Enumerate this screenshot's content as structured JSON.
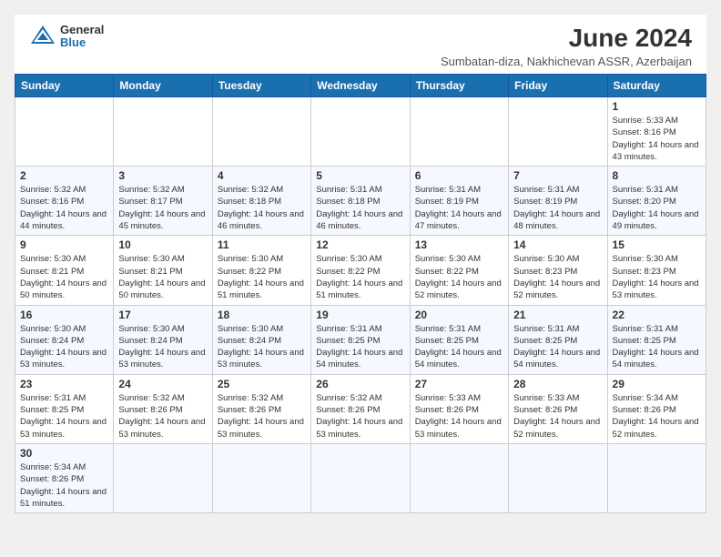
{
  "header": {
    "logo_general": "General",
    "logo_blue": "Blue",
    "month_title": "June 2024",
    "subtitle": "Sumbatan-diza, Nakhichevan ASSR, Azerbaijan"
  },
  "days_of_week": [
    "Sunday",
    "Monday",
    "Tuesday",
    "Wednesday",
    "Thursday",
    "Friday",
    "Saturday"
  ],
  "weeks": [
    [
      {
        "day": "",
        "info": ""
      },
      {
        "day": "",
        "info": ""
      },
      {
        "day": "",
        "info": ""
      },
      {
        "day": "",
        "info": ""
      },
      {
        "day": "",
        "info": ""
      },
      {
        "day": "",
        "info": ""
      },
      {
        "day": "1",
        "info": "Sunrise: 5:33 AM\nSunset: 8:16 PM\nDaylight: 14 hours\nand 43 minutes."
      }
    ],
    [
      {
        "day": "2",
        "info": "Sunrise: 5:32 AM\nSunset: 8:16 PM\nDaylight: 14 hours\nand 44 minutes."
      },
      {
        "day": "3",
        "info": "Sunrise: 5:32 AM\nSunset: 8:17 PM\nDaylight: 14 hours\nand 45 minutes."
      },
      {
        "day": "4",
        "info": "Sunrise: 5:32 AM\nSunset: 8:18 PM\nDaylight: 14 hours\nand 46 minutes."
      },
      {
        "day": "5",
        "info": "Sunrise: 5:31 AM\nSunset: 8:18 PM\nDaylight: 14 hours\nand 46 minutes."
      },
      {
        "day": "6",
        "info": "Sunrise: 5:31 AM\nSunset: 8:19 PM\nDaylight: 14 hours\nand 47 minutes."
      },
      {
        "day": "7",
        "info": "Sunrise: 5:31 AM\nSunset: 8:19 PM\nDaylight: 14 hours\nand 48 minutes."
      },
      {
        "day": "8",
        "info": "Sunrise: 5:31 AM\nSunset: 8:20 PM\nDaylight: 14 hours\nand 49 minutes."
      }
    ],
    [
      {
        "day": "9",
        "info": "Sunrise: 5:30 AM\nSunset: 8:21 PM\nDaylight: 14 hours\nand 50 minutes."
      },
      {
        "day": "10",
        "info": "Sunrise: 5:30 AM\nSunset: 8:21 PM\nDaylight: 14 hours\nand 50 minutes."
      },
      {
        "day": "11",
        "info": "Sunrise: 5:30 AM\nSunset: 8:22 PM\nDaylight: 14 hours\nand 51 minutes."
      },
      {
        "day": "12",
        "info": "Sunrise: 5:30 AM\nSunset: 8:22 PM\nDaylight: 14 hours\nand 51 minutes."
      },
      {
        "day": "13",
        "info": "Sunrise: 5:30 AM\nSunset: 8:22 PM\nDaylight: 14 hours\nand 52 minutes."
      },
      {
        "day": "14",
        "info": "Sunrise: 5:30 AM\nSunset: 8:23 PM\nDaylight: 14 hours\nand 52 minutes."
      },
      {
        "day": "15",
        "info": "Sunrise: 5:30 AM\nSunset: 8:23 PM\nDaylight: 14 hours\nand 53 minutes."
      }
    ],
    [
      {
        "day": "16",
        "info": "Sunrise: 5:30 AM\nSunset: 8:24 PM\nDaylight: 14 hours\nand 53 minutes."
      },
      {
        "day": "17",
        "info": "Sunrise: 5:30 AM\nSunset: 8:24 PM\nDaylight: 14 hours\nand 53 minutes."
      },
      {
        "day": "18",
        "info": "Sunrise: 5:30 AM\nSunset: 8:24 PM\nDaylight: 14 hours\nand 53 minutes."
      },
      {
        "day": "19",
        "info": "Sunrise: 5:31 AM\nSunset: 8:25 PM\nDaylight: 14 hours\nand 54 minutes."
      },
      {
        "day": "20",
        "info": "Sunrise: 5:31 AM\nSunset: 8:25 PM\nDaylight: 14 hours\nand 54 minutes."
      },
      {
        "day": "21",
        "info": "Sunrise: 5:31 AM\nSunset: 8:25 PM\nDaylight: 14 hours\nand 54 minutes."
      },
      {
        "day": "22",
        "info": "Sunrise: 5:31 AM\nSunset: 8:25 PM\nDaylight: 14 hours\nand 54 minutes."
      }
    ],
    [
      {
        "day": "23",
        "info": "Sunrise: 5:31 AM\nSunset: 8:25 PM\nDaylight: 14 hours\nand 53 minutes."
      },
      {
        "day": "24",
        "info": "Sunrise: 5:32 AM\nSunset: 8:26 PM\nDaylight: 14 hours\nand 53 minutes."
      },
      {
        "day": "25",
        "info": "Sunrise: 5:32 AM\nSunset: 8:26 PM\nDaylight: 14 hours\nand 53 minutes."
      },
      {
        "day": "26",
        "info": "Sunrise: 5:32 AM\nSunset: 8:26 PM\nDaylight: 14 hours\nand 53 minutes."
      },
      {
        "day": "27",
        "info": "Sunrise: 5:33 AM\nSunset: 8:26 PM\nDaylight: 14 hours\nand 53 minutes."
      },
      {
        "day": "28",
        "info": "Sunrise: 5:33 AM\nSunset: 8:26 PM\nDaylight: 14 hours\nand 52 minutes."
      },
      {
        "day": "29",
        "info": "Sunrise: 5:34 AM\nSunset: 8:26 PM\nDaylight: 14 hours\nand 52 minutes."
      }
    ],
    [
      {
        "day": "30",
        "info": "Sunrise: 5:34 AM\nSunset: 8:26 PM\nDaylight: 14 hours\nand 51 minutes."
      },
      {
        "day": "",
        "info": ""
      },
      {
        "day": "",
        "info": ""
      },
      {
        "day": "",
        "info": ""
      },
      {
        "day": "",
        "info": ""
      },
      {
        "day": "",
        "info": ""
      },
      {
        "day": "",
        "info": ""
      }
    ]
  ]
}
